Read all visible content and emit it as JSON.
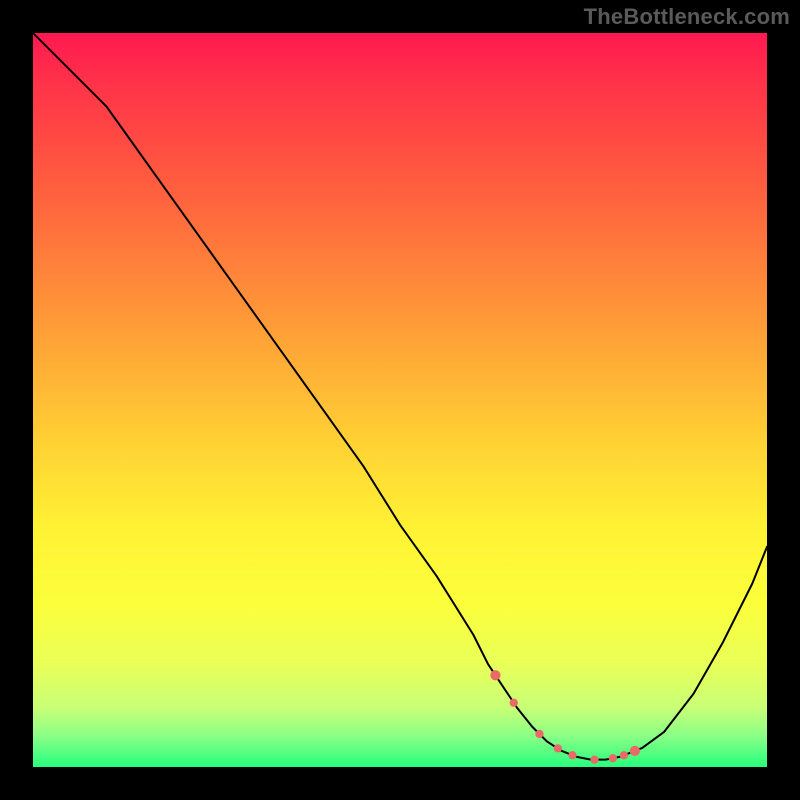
{
  "watermark": "TheBottleneck.com",
  "chart_data": {
    "type": "line",
    "title": "",
    "xlabel": "",
    "ylabel": "",
    "xlim": [
      0,
      100
    ],
    "ylim": [
      0,
      100
    ],
    "series": [
      {
        "name": "bottleneck-curve",
        "x": [
          0,
          5,
          10,
          15,
          20,
          25,
          30,
          35,
          40,
          45,
          50,
          55,
          60,
          62,
          64,
          66,
          68,
          70,
          72,
          74,
          76,
          78,
          80,
          83,
          86,
          90,
          94,
          98,
          100
        ],
        "values": [
          100,
          95,
          90,
          83,
          76,
          69,
          62,
          55,
          48,
          41,
          33,
          26,
          18,
          14,
          11,
          8,
          5.5,
          3.5,
          2.2,
          1.4,
          1.0,
          1.0,
          1.4,
          2.6,
          4.8,
          10,
          17,
          25,
          30
        ]
      }
    ],
    "markers": {
      "name": "bottom-dots",
      "color": "#ea6a67",
      "x": [
        63,
        65.5,
        69,
        71.5,
        73.5,
        76.5,
        79,
        80.5,
        82
      ],
      "sizes": [
        3.2,
        2.6,
        2.6,
        2.6,
        2.6,
        2.6,
        2.6,
        2.6,
        3.2
      ]
    },
    "colors": {
      "curve": "#000000",
      "background_top": "#ff1950",
      "background_bottom": "#26ff7c",
      "frame": "#000000"
    }
  }
}
